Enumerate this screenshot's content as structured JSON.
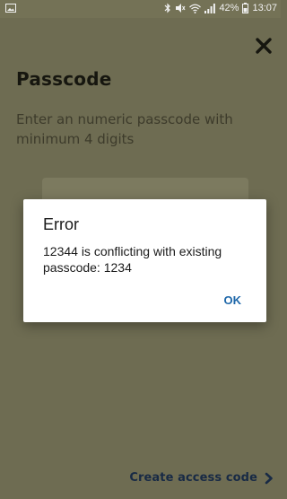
{
  "status_bar": {
    "battery": "42%",
    "time": "13:07",
    "icons": [
      "gallery-icon",
      "bluetooth-icon",
      "mute-icon",
      "wifi-icon",
      "signal-icon",
      "battery-icon"
    ]
  },
  "page": {
    "title": "Passcode",
    "subtitle": "Enter an numeric passcode with minimum 4 digits",
    "create_access_label": "Create access code",
    "close_icon": "close-icon",
    "chevron_icon": "chevron-right-icon"
  },
  "dialog": {
    "title": "Error",
    "message": "12344 is conflicting with existing passcode: 1234",
    "ok_label": "OK"
  },
  "colors": {
    "scrim_background": "#6e6c52",
    "dialog_background": "#ffffff",
    "ok_accent": "#1e67a9",
    "create_access_text": "#182a45"
  }
}
